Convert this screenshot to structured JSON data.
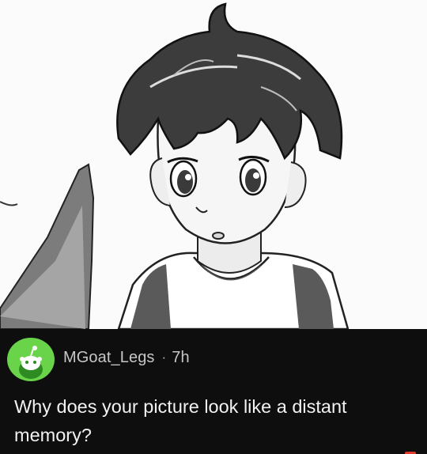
{
  "comment": {
    "username": "MGoat_Legs",
    "separator": "·",
    "age": "7h",
    "body": "Why does your picture look like a distant memory?"
  },
  "icons": {
    "avatar": "reddit-snoo-avatar-icon"
  },
  "colors": {
    "avatar_background": "#69d34a",
    "card_background": "#0e0e0e",
    "username_text": "#c7c7c7",
    "comment_text": "#f2f2f2"
  }
}
